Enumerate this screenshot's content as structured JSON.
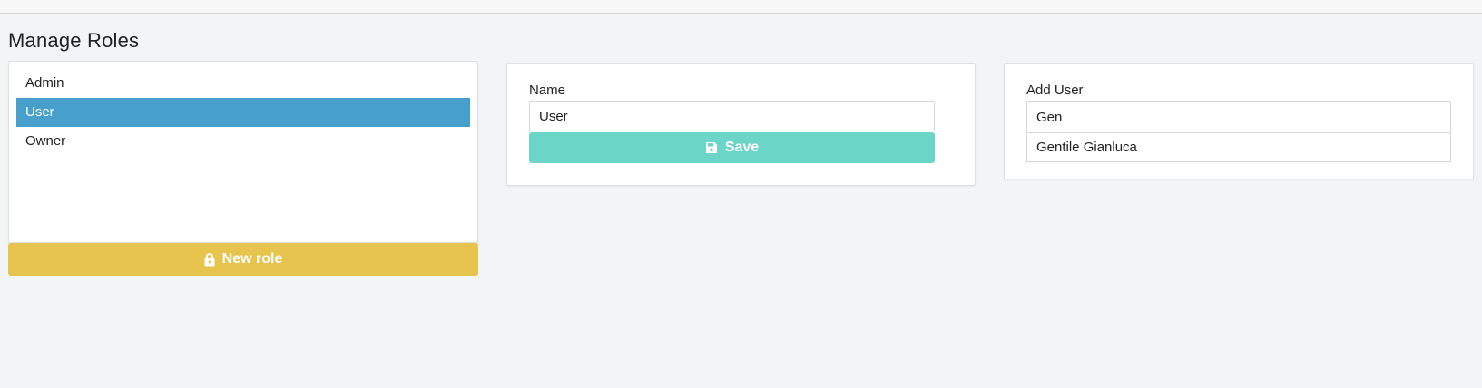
{
  "page": {
    "title": "Manage Roles"
  },
  "roles": {
    "items": [
      {
        "label": "Admin",
        "selected": false
      },
      {
        "label": "User",
        "selected": true
      },
      {
        "label": "Owner",
        "selected": false
      }
    ],
    "new_role_button": {
      "label": "New role",
      "icon": "lock-icon"
    }
  },
  "role_editor": {
    "name_label": "Name",
    "name_value": "User",
    "save_button": {
      "label": "Save",
      "icon": "floppy-disk-icon"
    }
  },
  "add_user": {
    "label": "Add User",
    "search_value": "Gen",
    "suggestions": [
      "Gentile Gianluca"
    ]
  },
  "colors": {
    "selected_row": "#479fcb",
    "new_role_button": "#e7c44d",
    "save_button": "#6bd6c8",
    "background": "#f3f4f6"
  }
}
